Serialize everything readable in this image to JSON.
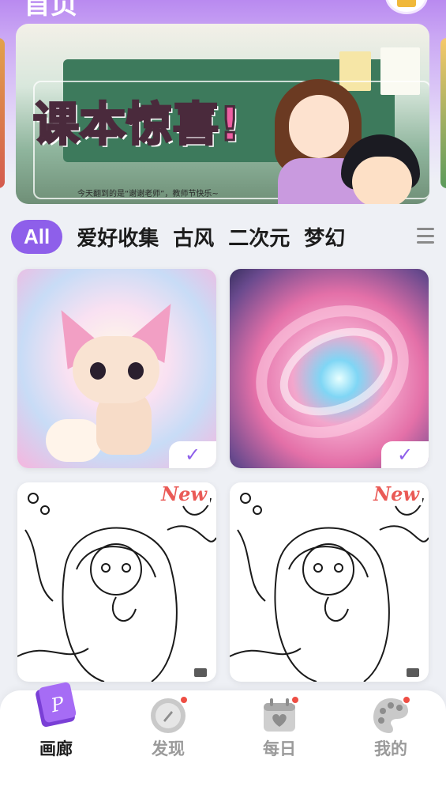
{
  "header": {
    "title": "首页"
  },
  "banner": {
    "title": "课本惊喜!",
    "subtitle": "今天翻到的是“谢谢老师”，教师节快乐~",
    "slides": 4,
    "active_slide": 1
  },
  "tabs": {
    "items": [
      "All",
      "爱好收集",
      "古风",
      "二次元",
      "梦幻"
    ],
    "active": "All",
    "more_icon": "menu-icon"
  },
  "gallery": {
    "items": [
      {
        "subject": "fennec fox artwork",
        "status": "completed",
        "status_icon": "check-icon"
      },
      {
        "subject": "pink galaxy with butterflies",
        "status": "completed",
        "status_icon": "check-icon"
      },
      {
        "subject": "girl with hood coloring page",
        "badge": "New",
        "media_icon": "video-icon"
      },
      {
        "subject": "girl with hood coloring page",
        "badge": "New",
        "media_icon": "video-icon"
      }
    ]
  },
  "bottom_nav": {
    "items": [
      {
        "label": "画廊",
        "icon": "gallery-book-icon",
        "active": true,
        "dot": false
      },
      {
        "label": "发现",
        "icon": "compass-icon",
        "active": false,
        "dot": true
      },
      {
        "label": "每日",
        "icon": "calendar-heart-icon",
        "active": false,
        "dot": true
      },
      {
        "label": "我的",
        "icon": "palette-icon",
        "active": false,
        "dot": true
      }
    ]
  },
  "colors": {
    "accent": "#8e5fea",
    "badge_new": "#ea5a56",
    "notification_dot": "#ee4e44",
    "header_gradient": "#b98af0"
  }
}
